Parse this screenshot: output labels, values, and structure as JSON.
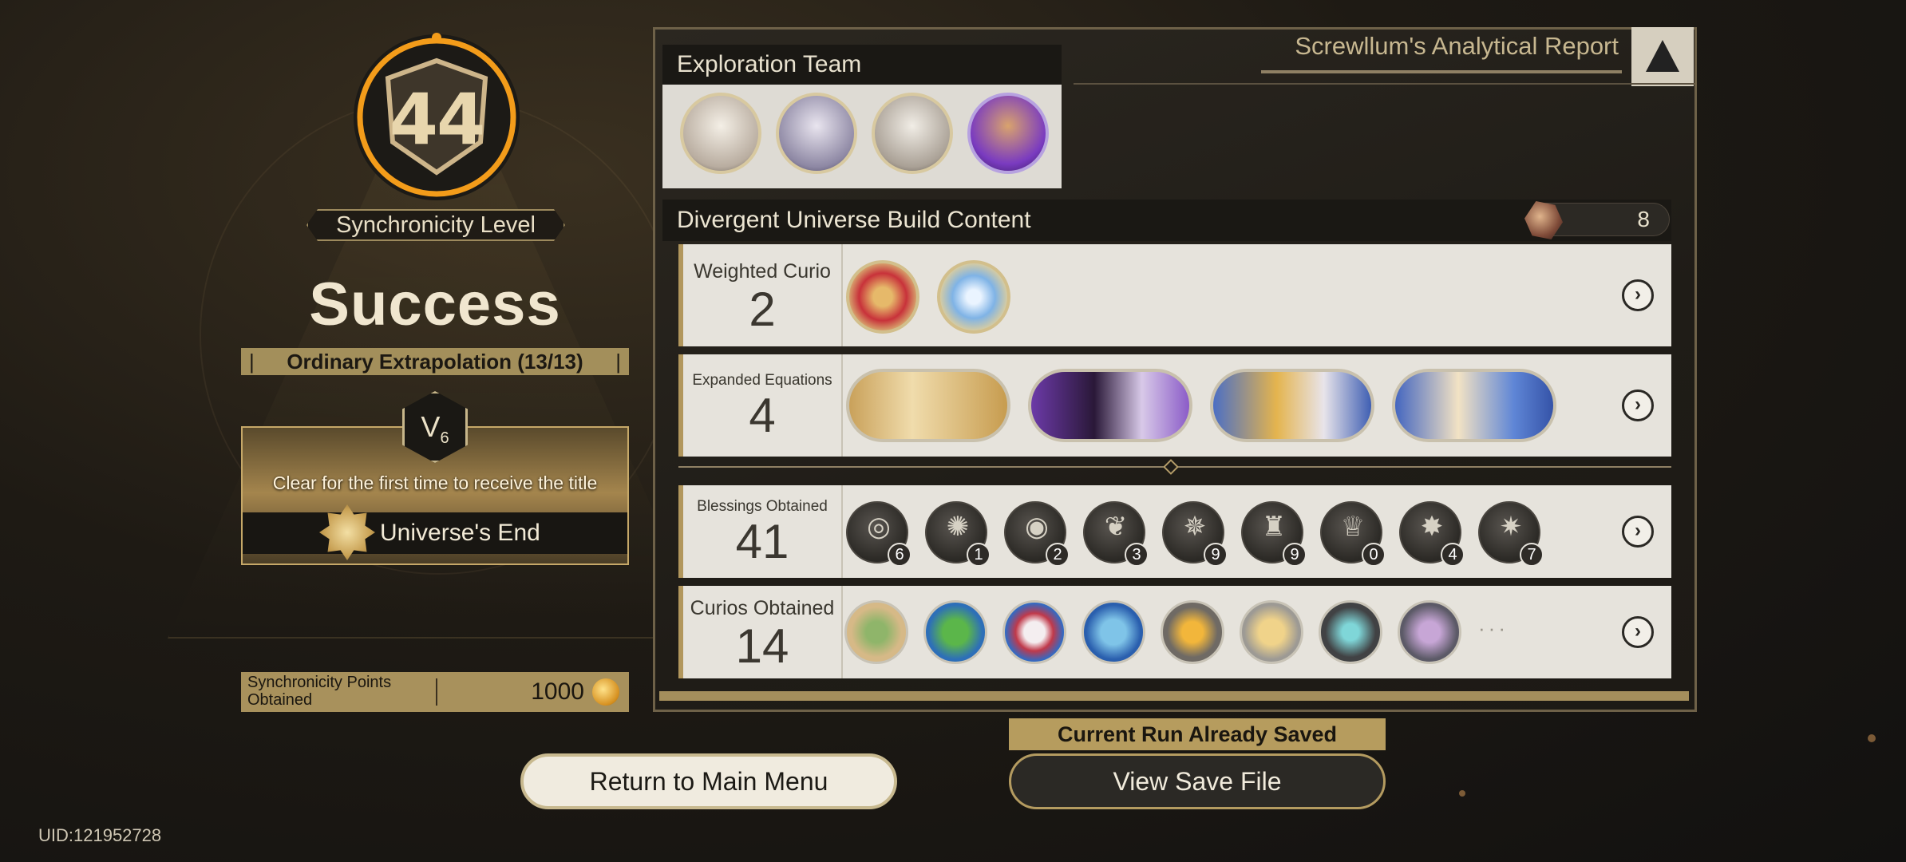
{
  "left": {
    "level": "44",
    "level_progress": 0.03,
    "sync_label": "Synchronicity Level",
    "result": "Success",
    "difficulty": "Ordinary Extrapolation (13/13)",
    "v_badge": {
      "letter": "V",
      "sub": "6"
    },
    "title_hint": "Clear for the first time to receive the title",
    "title_name": "Universe's End",
    "sync_points_label": "Synchronicity Points Obtained",
    "sync_points_value": "1000",
    "buttons": {
      "main_menu": "Return to Main Menu"
    },
    "uid": "UID:121952728"
  },
  "report": {
    "title": "Screwllum's Analytical Report",
    "team_heading": "Exploration Team",
    "team": [
      {
        "name": "character-1",
        "color": "#d8d0c4"
      },
      {
        "name": "character-2",
        "color": "#b9b5c6"
      },
      {
        "name": "character-3",
        "color": "#cfc8bf"
      },
      {
        "name": "character-4",
        "color": "#7a3bc0"
      }
    ],
    "build_heading": "Divergent Universe Build Content",
    "build_count": "8",
    "weighted_curio": {
      "label": "Weighted Curio",
      "count": "2"
    },
    "expanded_equations": {
      "label": "Expanded Equations",
      "count": "4"
    },
    "blessings": {
      "label": "Blessings Obtained",
      "count": "41",
      "items": [
        {
          "glyph": "◎",
          "count": "6"
        },
        {
          "glyph": "✺",
          "count": "1"
        },
        {
          "glyph": "◉",
          "count": "2"
        },
        {
          "glyph": "❦",
          "count": "3"
        },
        {
          "glyph": "✵",
          "count": "9"
        },
        {
          "glyph": "♜",
          "count": "9"
        },
        {
          "glyph": "♕",
          "count": "0"
        },
        {
          "glyph": "✸",
          "count": "4"
        },
        {
          "glyph": "✷",
          "count": "7"
        }
      ]
    },
    "curios": {
      "label": "Curios Obtained",
      "count": "14",
      "more": "···"
    }
  },
  "save": {
    "tag": "Current Run Already Saved",
    "button": "View Save File"
  },
  "colors": {
    "accent_gold": "#b69c5e",
    "level_ring": "#f39c1a",
    "panel_bg": "#1f1c17"
  },
  "icons": {
    "arrow": "›",
    "report": "triangle-emblem-icon",
    "coin": "sync-coin-icon"
  }
}
